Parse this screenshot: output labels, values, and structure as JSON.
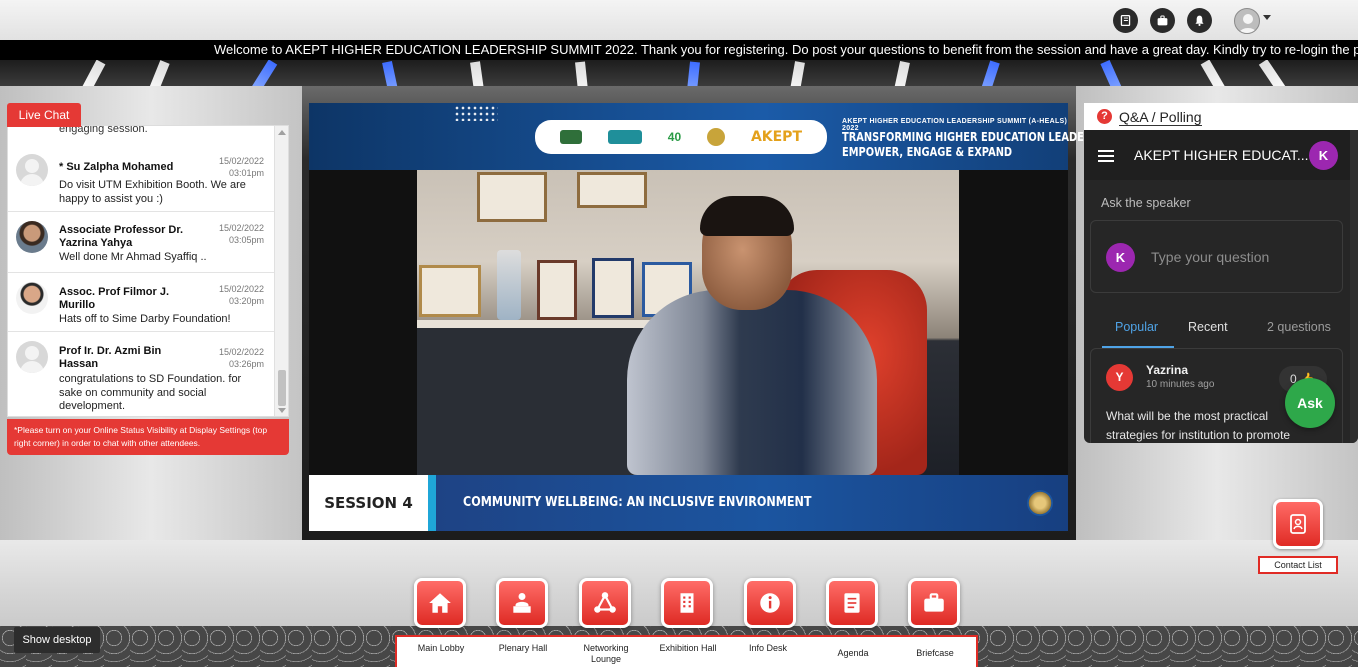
{
  "marquee": {
    "text": "Welcome to AKEPT HIGHER EDUCATION LEADERSHIP SUMMIT 2022. Thank you for registering. Do post your questions to benefit from the session and have a great day. Kindly try to re-login the platform to access plenary hall"
  },
  "top_icons": [
    "notebook-icon",
    "briefcase-icon",
    "bell-icon",
    "user-avatar-icon"
  ],
  "video": {
    "banner": {
      "summit": "AKEPT HIGHER EDUCATION LEADERSHIP SUMMIT (A-HEALS) 2022",
      "title_line1": "TRANSFORMING HIGHER EDUCATION LEADERS:",
      "title_line2": "EMPOWER, ENGAGE & EXPAND",
      "logo_text": "AKEPT",
      "anniversary": "40"
    },
    "session_label": "SESSION 4",
    "session_title": "COMMUNITY WELLBEING: AN INCLUSIVE ENVIRONMENT"
  },
  "live_chat": {
    "tab_label": "Live Chat",
    "top_snippet": "engaging session.",
    "messages": [
      {
        "name": "* Su Zalpha Mohamed",
        "date": "15/02/2022",
        "time": "03:01pm",
        "text": "Do visit UTM Exhibition Booth. We are happy to assist you :)"
      },
      {
        "name": "Associate Professor Dr. Yazrina Yahya",
        "date": "15/02/2022",
        "time": "03:05pm",
        "text": "Well done Mr Ahmad Syaffiq .."
      },
      {
        "name": "Assoc. Prof Filmor J. Murillo",
        "date": "15/02/2022",
        "time": "03:20pm",
        "text": "Hats off to Sime Darby Foundation!"
      },
      {
        "name": "Prof Ir. Dr. Azmi Bin Hassan",
        "date": "15/02/2022",
        "time": "03:26pm",
        "text": "congratulations to SD Foundation. for sake on community and social development."
      }
    ],
    "warning": "*Please turn on your Online Status Visibility at Display Settings (top right corner) in order to chat with other attendees."
  },
  "qa": {
    "title": "Q&A / Polling",
    "event_title": "AKEPT HIGHER EDUCAT...",
    "user_initial": "K",
    "ask_label": "Ask the speaker",
    "input_placeholder": "Type your question",
    "tabs": {
      "popular": "Popular",
      "recent": "Recent"
    },
    "question_count": "2 questions",
    "question": {
      "initial": "Y",
      "author": "Yazrina",
      "time": "10 minutes ago",
      "likes": "0",
      "text": "What will be the most practical strategies for institution to promote"
    },
    "ask_button": "Ask"
  },
  "contact_list": {
    "label": "Contact List"
  },
  "nav": [
    {
      "label": "Main Lobby",
      "icon": "home-icon"
    },
    {
      "label": "Plenary Hall",
      "icon": "presenter-icon"
    },
    {
      "label": "Networking Lounge",
      "icon": "network-icon"
    },
    {
      "label": "Exhibition Hall",
      "icon": "building-icon"
    },
    {
      "label": "Info Desk",
      "icon": "info-icon"
    },
    {
      "label": "Agenda",
      "icon": "agenda-book-icon"
    },
    {
      "label": "Briefcase",
      "icon": "briefcase-icon"
    }
  ],
  "taskbar": {
    "show_desktop": "Show desktop"
  },
  "colors": {
    "accent_red": "#e53935",
    "qa_blue": "#4fa3e6",
    "ask_green": "#2ea84a",
    "avatar_purple": "#9c27b0"
  }
}
